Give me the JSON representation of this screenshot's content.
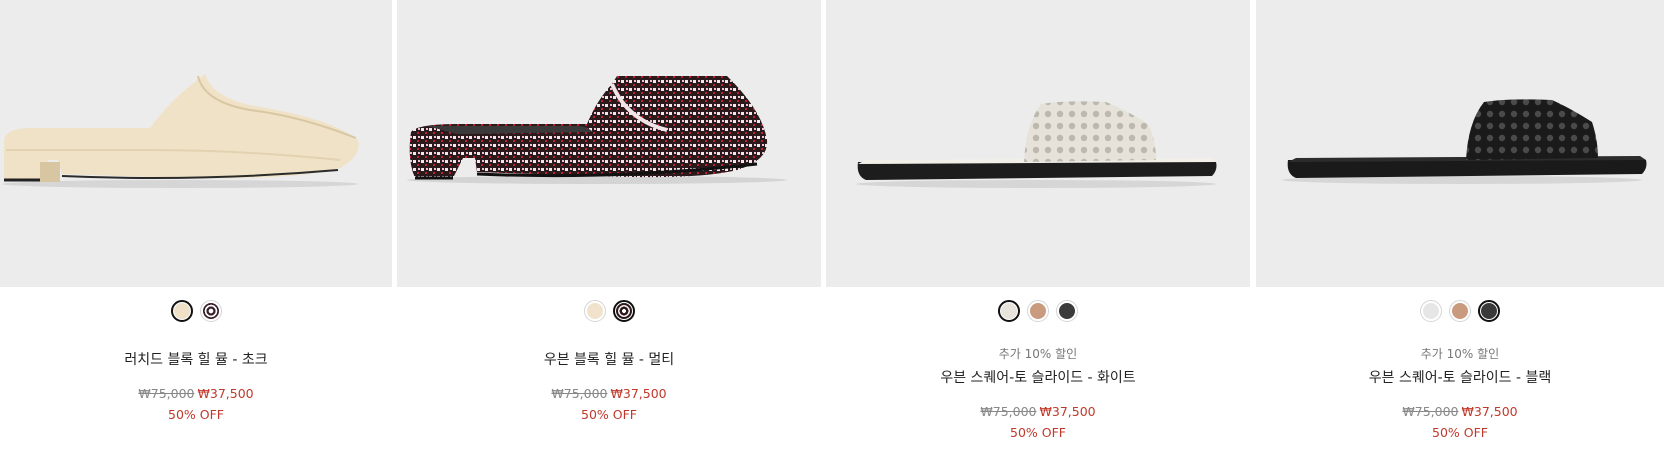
{
  "products": [
    {
      "name": "러치드 블록 힐 뮬 - 초크",
      "promo": "",
      "original_price": "₩75,000",
      "sale_price": "₩37,500",
      "discount": "50% OFF",
      "swatches": [
        {
          "color": "#efe0c8",
          "selected": true
        },
        {
          "color": "#3a1f2a",
          "selected": false
        }
      ]
    },
    {
      "name": "우븐 블록 힐 뮬 - 멀티",
      "promo": "",
      "original_price": "₩75,000",
      "sale_price": "₩37,500",
      "discount": "50% OFF",
      "swatches": [
        {
          "color": "#f1e2cc",
          "selected": false
        },
        {
          "color": "#2a1a1e",
          "selected": true
        }
      ]
    },
    {
      "name": "우븐 스퀘어-토 슬라이드 - 화이트",
      "promo": "추가 10% 할인",
      "original_price": "₩75,000",
      "sale_price": "₩37,500",
      "discount": "50% OFF",
      "swatches": [
        {
          "color": "#e8e4dc",
          "selected": true
        },
        {
          "color": "#c99a7e",
          "selected": false
        },
        {
          "color": "#3a3a3a",
          "selected": false
        }
      ]
    },
    {
      "name": "우븐 스퀘어-토 슬라이드 - 블랙",
      "promo": "추가 10% 할인",
      "original_price": "₩75,000",
      "sale_price": "₩37,500",
      "discount": "50% OFF",
      "swatches": [
        {
          "color": "#e6e6e6",
          "selected": false
        },
        {
          "color": "#c99a7e",
          "selected": false
        },
        {
          "color": "#3a3a3a",
          "selected": true
        }
      ]
    }
  ]
}
